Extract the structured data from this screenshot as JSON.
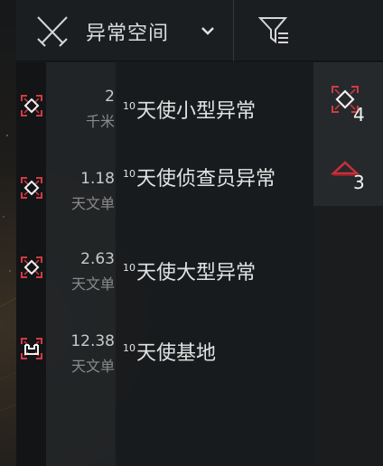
{
  "header": {
    "title": "异常空间",
    "icons": {
      "type": "crossed-swords-icon",
      "dropdown": "chevron-down-icon",
      "filter": "filter-icon"
    }
  },
  "sites": [
    {
      "distance": "2",
      "unit": "千米",
      "level": "10",
      "name": "天使小型异常",
      "icon": "anomaly-diamond-icon"
    },
    {
      "distance": "1.18",
      "unit": "天文单",
      "level": "10",
      "name": "天使侦查员异常",
      "icon": "anomaly-diamond-icon"
    },
    {
      "distance": "2.63",
      "unit": "天文单",
      "level": "10",
      "name": "天使大型异常",
      "icon": "anomaly-diamond-icon"
    },
    {
      "distance": "12.38",
      "unit": "天文单",
      "level": "10",
      "name": "天使基地",
      "icon": "outpost-icon"
    }
  ],
  "groups": [
    {
      "icon": "anomaly-diamond-group-icon",
      "count": "4"
    },
    {
      "icon": "signature-triangle-group-icon",
      "count": "3"
    }
  ],
  "colors": {
    "accent": "#c8303a",
    "bracket": "#d23a44"
  }
}
